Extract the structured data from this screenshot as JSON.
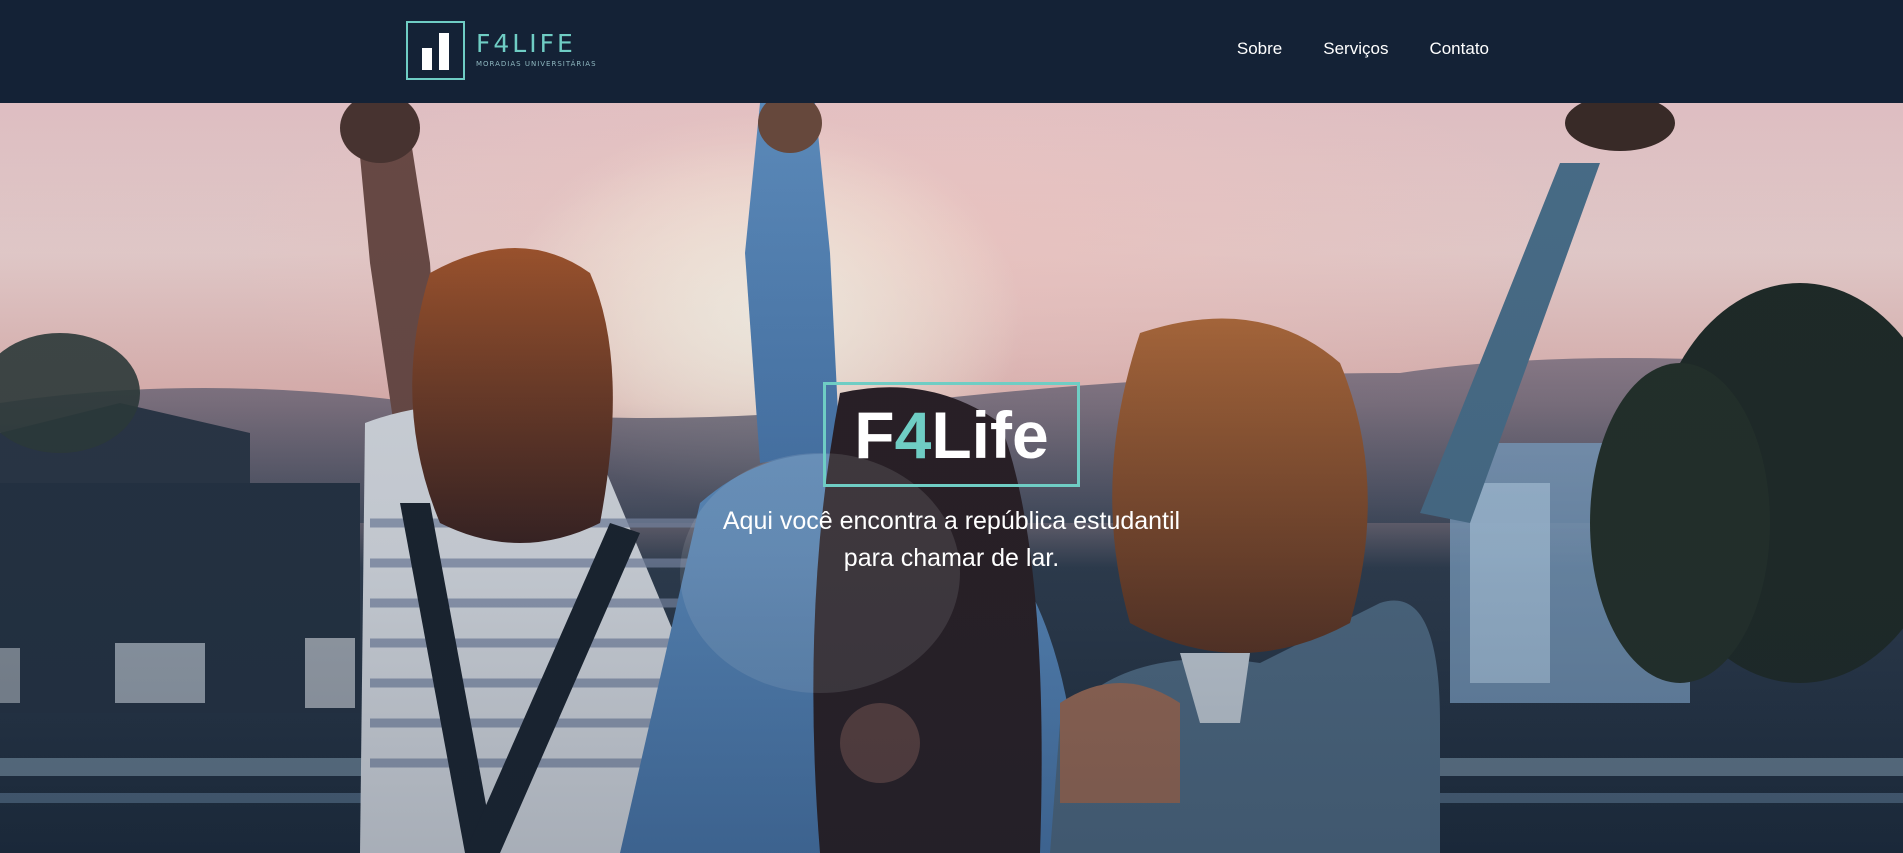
{
  "header": {
    "logo": {
      "name": "F4LIFE",
      "tagline": "MORADIAS UNIVERSITÁRIAS",
      "icon": "bar-chart-icon"
    },
    "nav": [
      {
        "label": "Sobre"
      },
      {
        "label": "Serviços"
      },
      {
        "label": "Contato"
      }
    ]
  },
  "hero": {
    "title_prefix": "F",
    "title_accent": "4",
    "title_suffix": "Life",
    "subtitle_line1": "Aqui você encontra a república estudantil",
    "subtitle_line2": "para chamar de lar.",
    "image_description": "photo-of-three-friends-raising-arms-at-sunset"
  },
  "colors": {
    "header_bg": "#142236",
    "accent": "#6fcdc4",
    "text": "#ffffff"
  }
}
